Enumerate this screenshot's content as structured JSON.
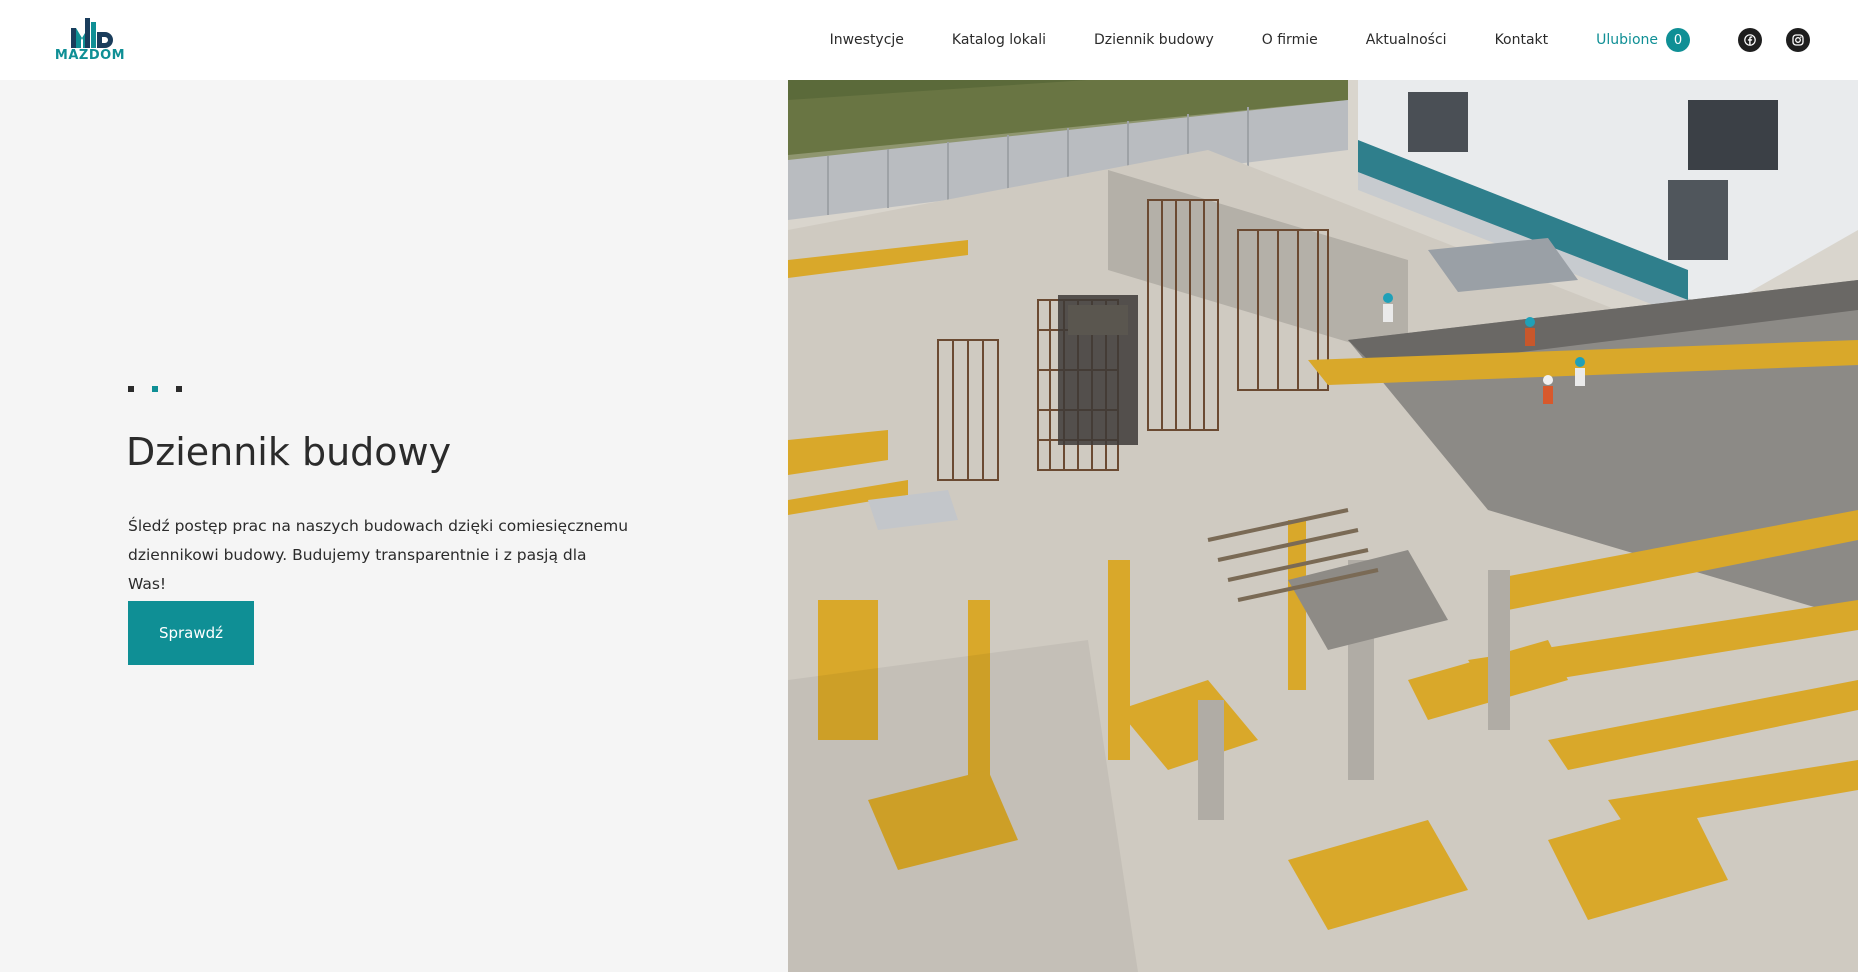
{
  "brand": {
    "name": "MAZDOM",
    "accent": "#0f8f95"
  },
  "nav": {
    "items": [
      "Inwestycje",
      "Katalog lokali",
      "Dziennik budowy",
      "O firmie",
      "Aktualności",
      "Kontakt"
    ],
    "favorites_label": "Ulubione",
    "favorites_count": "0",
    "social": [
      {
        "icon": "facebook-icon"
      },
      {
        "icon": "instagram-icon"
      }
    ]
  },
  "hero": {
    "title": "Dziennik budowy",
    "description": "Śledź postęp prac na naszych budowach dzięki comiesięcznemu dziennikowi budowy. Budujemy transparentnie i z pasją dla Was!",
    "cta_label": "Sprawdź"
  }
}
